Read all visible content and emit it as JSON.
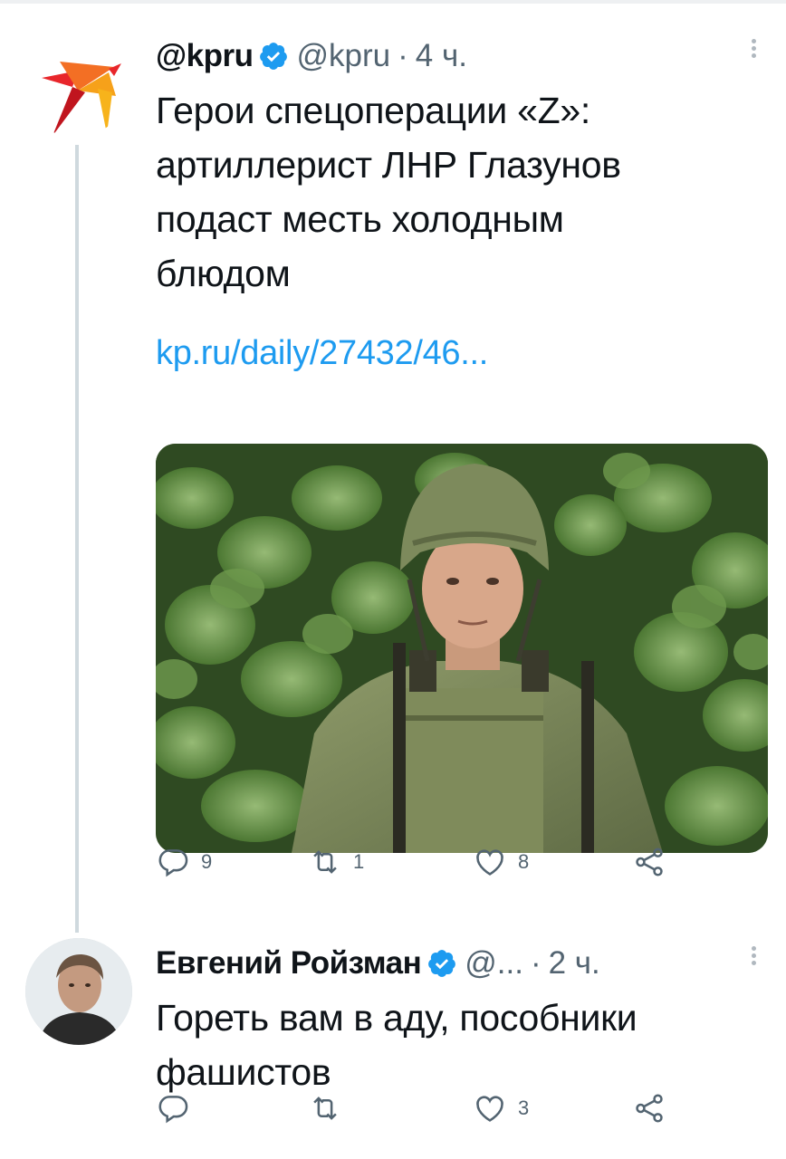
{
  "tweets": [
    {
      "display_name": "@kpru",
      "handle": "@kpru",
      "dot": "·",
      "time": "4 ч.",
      "text_lines": [
        "Герои спецоперации «Z»:",
        "артиллерист ЛНР Глазунов",
        "подаст месть холодным",
        "блюдом"
      ],
      "link": "kp.ru/daily/27432/46...",
      "avatar_icon": "kp-bird-logo-icon",
      "media_icon": "soldier-photo",
      "reply_count": "9",
      "retweet_count": "1",
      "like_count": "8"
    },
    {
      "display_name": "Евгений Ройзман",
      "handle": "@...",
      "dot": "·",
      "time": "2 ч.",
      "text_lines": [
        "Гореть вам в аду, пособники",
        "фашистов"
      ],
      "avatar_icon": "user-avatar",
      "reply_count": "",
      "retweet_count": "",
      "like_count": "3"
    }
  ],
  "colors": {
    "accent": "#1d9bf0",
    "secondary_text": "#536471",
    "primary_text": "#0f1419",
    "thread_line": "#cfd9de"
  }
}
